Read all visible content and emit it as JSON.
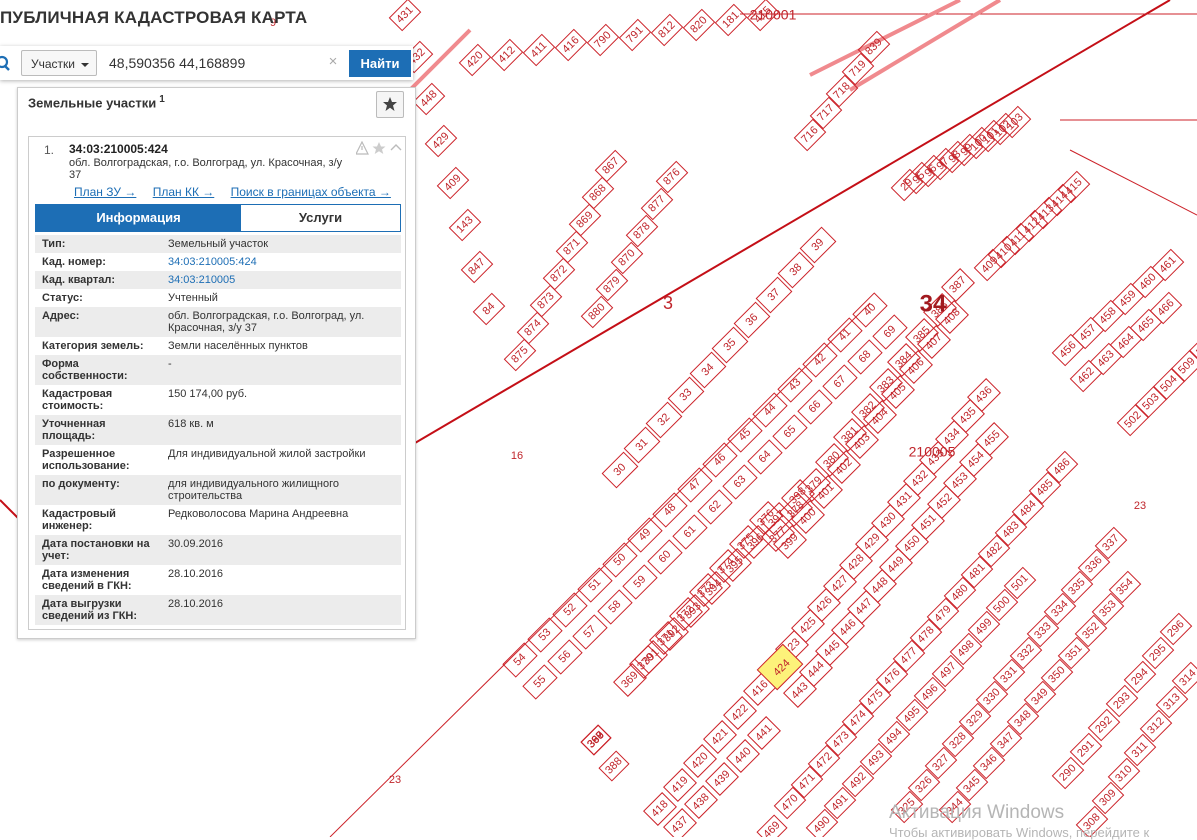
{
  "app": {
    "title": "ПУБЛИЧНАЯ КАДАСТРОВАЯ КАРТА"
  },
  "search": {
    "type_label": "Участки",
    "value": "48,590356 44,168899",
    "placeholder": "",
    "button_label": "Найти"
  },
  "panel": {
    "title": "Земельные участки",
    "count": "1",
    "result": {
      "index": "1.",
      "cad_number": "34:03:210005:424",
      "address": "обл. Волгоградская, г.о. Волгоград, ул. Красочная, з/у 37",
      "links": [
        "План ЗУ →",
        "План КК →",
        "Поиск в границах объекта →"
      ]
    },
    "tabs": [
      {
        "label": "Информация",
        "active": true
      },
      {
        "label": "Услуги",
        "active": false
      }
    ],
    "info": [
      {
        "key": "Тип:",
        "value": "Земельный участок"
      },
      {
        "key": "Кад. номер:",
        "value": "34:03:210005:424",
        "link": true
      },
      {
        "key": "Кад. квартал:",
        "value": "34:03:210005",
        "link": true
      },
      {
        "key": "Статус:",
        "value": "Учтенный"
      },
      {
        "key": "Адрес:",
        "value": "обл. Волгоградская, г.о. Волгоград, ул. Красочная, з/у 37"
      },
      {
        "key": "Категория земель:",
        "value": "Земли населённых пунктов"
      },
      {
        "key": "Форма собственности:",
        "value": "-"
      },
      {
        "key": "Кадастровая стоимость:",
        "value": "150 174,00 руб."
      },
      {
        "key": "Уточненная площадь:",
        "value": "618 кв. м"
      },
      {
        "key": "Разрешенное использование:",
        "value": "Для индивидуальной жилой застройки"
      },
      {
        "key": "по документу:",
        "value": "для индивидуального жилищного строительства"
      },
      {
        "key": "Кадастровый инженер:",
        "value": "Редковолосова Марина Андреевна"
      },
      {
        "key": "Дата постановки на учет:",
        "value": "30.09.2016"
      },
      {
        "key": "Дата изменения сведений в ГКН:",
        "value": "28.10.2016"
      },
      {
        "key": "Дата выгрузки сведений из ГКН:",
        "value": "28.10.2016"
      }
    ]
  },
  "map": {
    "colors": {
      "boundary": "#cc2229",
      "highlight_fill": "#fdf27a",
      "thick_line": "#c40f17"
    },
    "region_label": "34",
    "quarter_labels": [
      "210001",
      "210005"
    ],
    "zone_labels": [
      "3",
      "16",
      "23",
      "23",
      "9"
    ],
    "highlighted_parcel": "424",
    "parcel_strips": [
      {
        "labels": [
          "54",
          "53",
          "52",
          "51",
          "50",
          "49",
          "48",
          "47",
          "46",
          "45",
          "44",
          "43",
          "42",
          "41",
          "40"
        ]
      },
      {
        "labels": [
          "55",
          "56",
          "57",
          "58",
          "59",
          "60",
          "61",
          "62",
          "63",
          "64",
          "65",
          "66",
          "67",
          "68",
          "69"
        ]
      },
      {
        "labels": [
          "30",
          "31",
          "32",
          "33",
          "34",
          "35",
          "36",
          "37",
          "38",
          "39"
        ]
      },
      {
        "labels": [
          "875",
          "874",
          "873",
          "872",
          "871",
          "869",
          "868",
          "867"
        ]
      },
      {
        "labels": [
          "880",
          "879",
          "870",
          "878",
          "877",
          "876"
        ]
      },
      {
        "labels": [
          "370",
          "371",
          "372",
          "373",
          "374",
          "375",
          "376"
        ]
      },
      {
        "labels": [
          "369",
          "391",
          "392",
          "393",
          "394",
          "395",
          "396",
          "397",
          "398"
        ]
      },
      {
        "labels": [
          "377",
          "378",
          "379",
          "380",
          "381",
          "382",
          "383",
          "384",
          "385",
          "386",
          "387"
        ]
      },
      {
        "labels": [
          "399",
          "400",
          "401",
          "402",
          "403",
          "404",
          "405",
          "406",
          "407",
          "408"
        ]
      },
      {
        "labels": [
          "367",
          "389",
          "368",
          "390"
        ]
      },
      {
        "labels": [
          "388"
        ]
      },
      {
        "labels": [
          "416",
          "415",
          "423",
          "425",
          "426",
          "427",
          "428",
          "429",
          "430",
          "431",
          "432",
          "433",
          "434",
          "435",
          "436"
        ]
      },
      {
        "labels": [
          "443",
          "444",
          "445",
          "446",
          "447",
          "448",
          "449",
          "450",
          "451",
          "452",
          "453",
          "454",
          "455"
        ]
      },
      {
        "labels": [
          "422",
          "421",
          "420",
          "419",
          "418"
        ]
      },
      {
        "labels": [
          "441",
          "440",
          "439",
          "438",
          "437"
        ]
      },
      {
        "labels": [
          "470",
          "471",
          "472",
          "473",
          "474",
          "475",
          "476",
          "477",
          "478",
          "479",
          "480",
          "481",
          "482",
          "483",
          "484",
          "485",
          "486"
        ]
      },
      {
        "labels": [
          "490",
          "491",
          "492",
          "493",
          "494",
          "495",
          "496",
          "497",
          "498",
          "499",
          "500",
          "501"
        ]
      },
      {
        "labels": [
          "469"
        ]
      },
      {
        "labels": [
          "344",
          "345",
          "346",
          "347",
          "348",
          "349",
          "350",
          "351",
          "352",
          "353",
          "354"
        ]
      },
      {
        "labels": [
          "325",
          "326",
          "327",
          "328",
          "329",
          "330",
          "331",
          "332",
          "333",
          "334",
          "335",
          "336",
          "337"
        ]
      },
      {
        "labels": [
          "308",
          "309",
          "310",
          "311",
          "312",
          "313",
          "314"
        ]
      },
      {
        "labels": [
          "290",
          "291",
          "292",
          "293",
          "294",
          "295",
          "296"
        ]
      },
      {
        "labels": [
          "456",
          "457",
          "458",
          "459",
          "460",
          "461"
        ]
      },
      {
        "labels": [
          "462",
          "463",
          "464",
          "465",
          "466"
        ]
      },
      {
        "labels": [
          "502",
          "503",
          "504",
          "509",
          "510"
        ]
      },
      {
        "labels": [
          "409",
          "410",
          "411",
          "412",
          "413",
          "414",
          "415"
        ]
      },
      {
        "labels": [
          "29",
          "95",
          "96",
          "97",
          "98",
          "99",
          "100",
          "101",
          "102",
          "103"
        ]
      },
      {
        "labels": [
          "716",
          "717",
          "718",
          "719",
          "839"
        ]
      },
      {
        "labels": [
          "420",
          "412",
          "411",
          "416",
          "790",
          "791",
          "812",
          "820",
          "181",
          "415"
        ]
      },
      {
        "labels": [
          "431",
          "432",
          "448",
          "429",
          "409",
          "143",
          "847",
          "84"
        ]
      }
    ],
    "watermark": {
      "line1": "Активация Windows",
      "line2": "Чтобы активировать Windows, перейдите к"
    }
  }
}
